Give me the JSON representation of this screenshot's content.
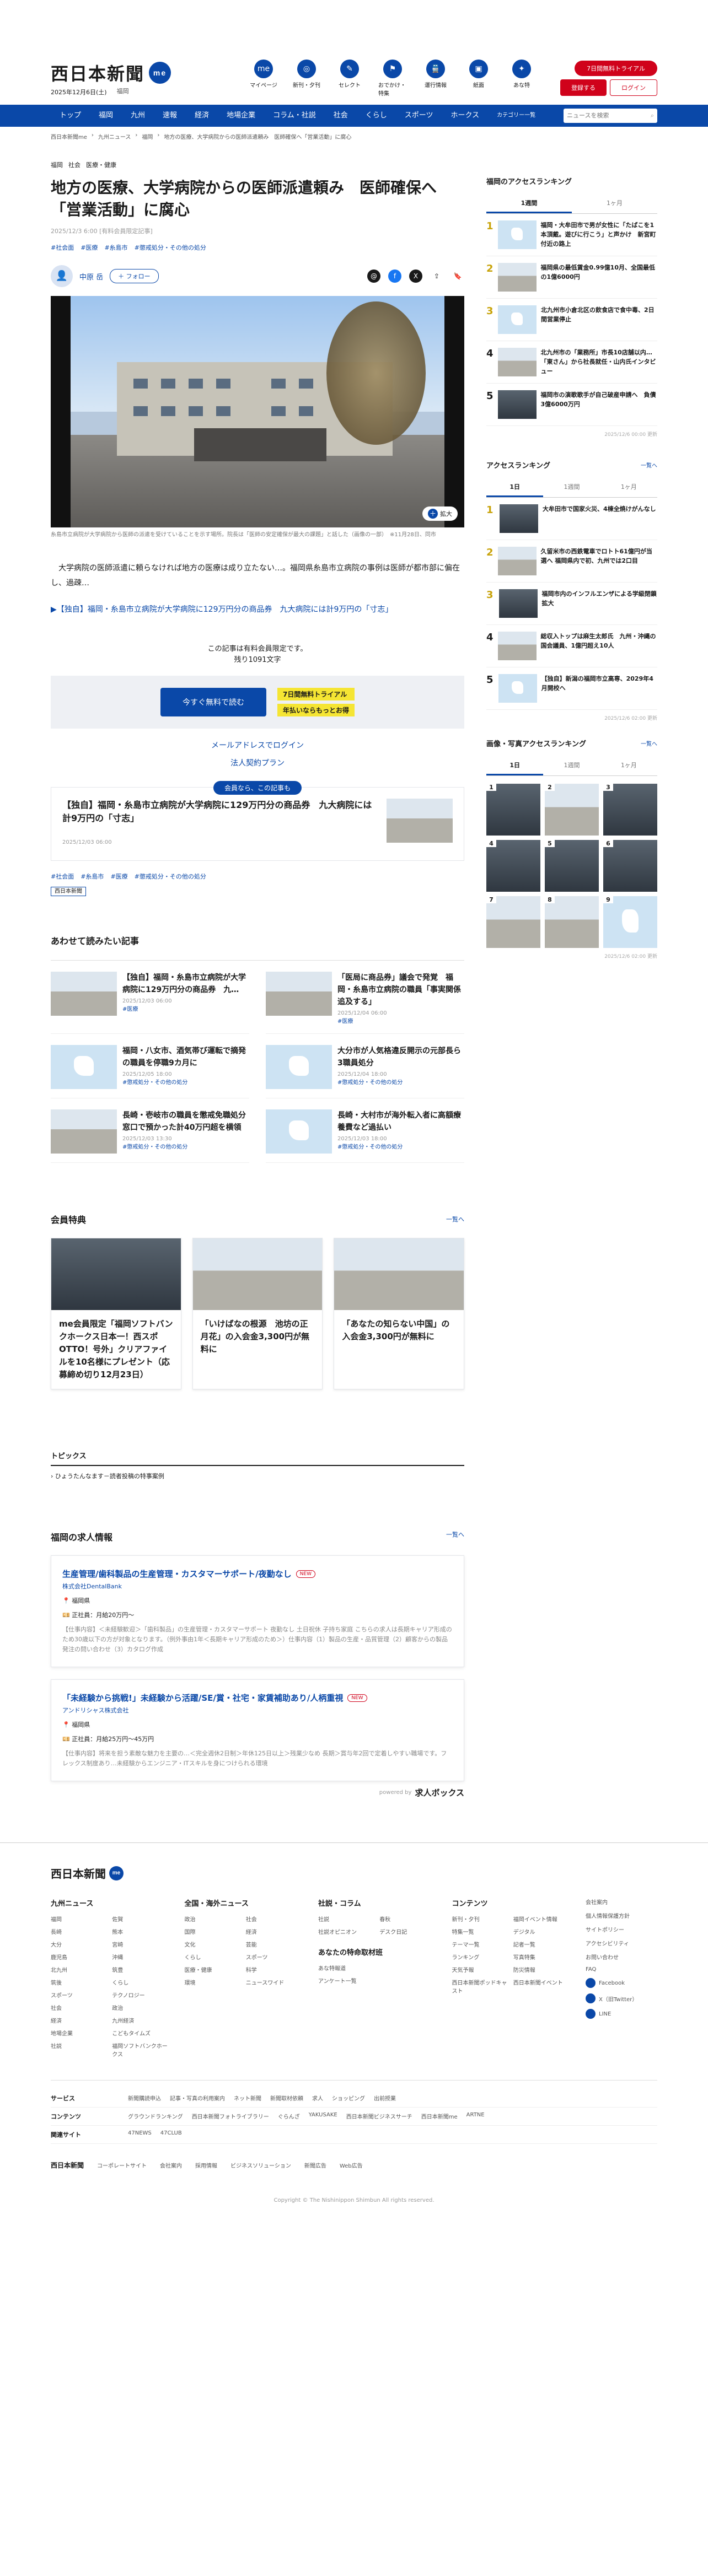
{
  "header": {
    "logo": "西日本新聞",
    "logo_me": "me",
    "date": "2025年12月6日(土)",
    "area": "福岡",
    "icons": [
      {
        "label": "マイページ",
        "icon": "mypage-icon",
        "glyph": "me"
      },
      {
        "label": "新刊・夕刊",
        "icon": "newspaper-icon",
        "glyph": "◎"
      },
      {
        "label": "セレクト",
        "icon": "select-icon",
        "glyph": "✎"
      },
      {
        "label": "おでかけ・特集",
        "icon": "outing-icon",
        "glyph": "⚑"
      },
      {
        "label": "運行情報",
        "icon": "train-icon",
        "glyph": "🚆"
      },
      {
        "label": "紙面",
        "icon": "paper-icon",
        "glyph": "▣"
      },
      {
        "label": "あな特",
        "icon": "anatoku-icon",
        "glyph": "✦"
      }
    ],
    "trial_button": "7日間無料トライアル",
    "register_button": "登録する",
    "login_button": "ログイン"
  },
  "nav": {
    "items": [
      "トップ",
      "福岡",
      "九州",
      "速報",
      "経済",
      "地場企業",
      "コラム・社説",
      "社会",
      "くらし",
      "スポーツ",
      "ホークス"
    ],
    "menu_label": "カテゴリー一覧",
    "search_placeholder": "ニュースを検索"
  },
  "breadcrumb": [
    "西日本新聞me",
    "九州ニュース",
    "福岡",
    "地方の医療、大学病院からの医師派遣頼み　医師確保へ「営業活動」に腐心"
  ],
  "article": {
    "categories": [
      "福岡",
      "社会",
      "医療・健康"
    ],
    "title": "地方の医療、大学病院からの医師派遣頼み　医師確保へ「営業活動」に腐心",
    "pubdate": "2025/12/3 6:00 [有料会員限定記事]",
    "tags": [
      "#社会面",
      "#医療",
      "#糸島市",
      "#懲戒処分・その他の処分"
    ],
    "author": "中原 岳",
    "follow": "＋ フォロー",
    "zoom": "拡大",
    "caption": "糸島市立病院が大学病院から医師の派遣を受けていることを示す場所。院長は「医師の安定確保が最大の課題」と話した（画像の一部）　※11月28日、同市",
    "lead": "　大学病院の医師派遣に頼らなければ地方の医療は成り立たない…。福岡県糸島市立病院の事例は医師が都市部に偏在し、過疎…",
    "scoop_link": "▶【独自】福岡・糸島市立病院が大学病院に129万円分の商品券　九大病院には計9万円の「寸志」"
  },
  "paywall": {
    "notice": "この記事は有料会員限定です。",
    "remaining": "残り1091文字",
    "subscribe_button": "今すぐ無料で読む",
    "badge1": "7日間無料トライアル",
    "badge2": "年払いならもっとお得",
    "login_link": "メールアドレスでログイン",
    "corp_link": "法人契約プラン"
  },
  "member_card": {
    "pill": "会員なら、この記事も",
    "title": "【独自】福岡・糸島市立病院が大学病院に129万円分の商品券　九大病院には計9万円の「寸志」",
    "date": "2025/12/03 06:00"
  },
  "tags2": [
    "#社会面",
    "#糸島市",
    "#医療",
    "#懲戒処分・その他の処分"
  ],
  "source_badge": "西日本新聞",
  "related": {
    "title": "あわせて読みたい記事",
    "items": [
      {
        "title": "【独自】福岡・糸島市立病院が大学病院に129万円分の商品券　九…",
        "meta": "2025/12/03 06:00",
        "tag": "#医療",
        "thumb": "bld"
      },
      {
        "title": "「医局に商品券」議会で発覚　福岡・糸島市立病院の職員「事実関係追及する」",
        "meta": "2025/12/04 06:00",
        "tag": "#医療",
        "thumb": "bld"
      },
      {
        "title": "福岡・八女市、酒気帯び運転で摘発の職員を停職9カ月に",
        "meta": "2025/12/05 18:00",
        "tag": "#懲戒処分・その他の処分",
        "thumb": "map"
      },
      {
        "title": "大分市が人気格違反開示の元部長ら3職員処分",
        "meta": "2025/12/04 18:00",
        "tag": "#懲戒処分・その他の処分",
        "thumb": "map"
      },
      {
        "title": "長崎・壱岐市の職員を懲戒免職処分　窓口で預かった計40万円超を横領",
        "meta": "2025/12/03 13:30",
        "tag": "#懲戒処分・その他の処分",
        "thumb": "bld"
      },
      {
        "title": "長崎・大村市が海外転入者に高額療養費など過払い",
        "meta": "2025/12/03 18:00",
        "tag": "#懲戒処分・その他の処分",
        "thumb": "map"
      }
    ]
  },
  "perks": {
    "title": "会員特典",
    "more": "一覧へ",
    "items": [
      {
        "title": "me会員限定「福岡ソフトバンクホークス日本一！西スポOTTO！号外」クリアファイルを10名様にプレゼント（応募締め切り12月23日）",
        "thumb": "dark"
      },
      {
        "title": "「いけばなの根源　池坊の正月花」の入会金3,300円が無料に",
        "thumb": "bld"
      },
      {
        "title": "「あなたの知らない中国」の入会金3,300円が無料に",
        "thumb": "bld"
      }
    ]
  },
  "topics": {
    "title": "トピックス",
    "items": [
      "ひょうたんなます－読者投稿の特事案例"
    ]
  },
  "jobs": {
    "title": "福岡の求人情報",
    "more": "一覧へ",
    "items": [
      {
        "title": "生産管理/歯科製品の生産管理・カスタマーサポート/夜勤なし",
        "new": "NEW",
        "company": "株式会社DentalBank",
        "location": "福岡県",
        "salary": "正社員：月給20万円～",
        "desc": "【仕事内容】＜未経験歓迎＞「歯科製品」の生産管理・カスタマーサポート 夜勤なし 土日祝休 子持ち家庭 こちらの求人は長期キャリア形成のため30歳以下の方が対象となります。（例外事由1年＜長期キャリア形成のため＞）仕事内容（1）製品の生産・品質管理（2）顧客からの製品発注の問い合わせ（3）カタログ作成"
      },
      {
        "title": "「未経験から挑戦!」未経験から活躍/SE/賞・社宅・家賃補助あり/人柄重視",
        "new": "NEW",
        "company": "アンドリシャス株式会社",
        "location": "福岡県",
        "salary": "正社員：月給25万円～45万円",
        "desc": "【仕事内容】将来を担う素敵な魅力を主要の…＜完全週休2日制＞年休125日以上＞残業少なめ 長期＞賞与年2回で定着しやすい職場です。フレックス制度あり…未経験からエンジニア・ITスキルを身につけられる環境"
      }
    ],
    "powered_label": "powered by",
    "powered_brand": "求人ボックス"
  },
  "sidebar": {
    "ranking1": {
      "title": "福岡のアクセスランキング",
      "tabs": [
        "1週間",
        "1ヶ月"
      ],
      "items": [
        {
          "num": "1",
          "text": "福岡・大牟田市で男が女性に「たばこを1本頂戴。遊びに行こう」と声かけ　新宮町付近の路上",
          "thumb": "map"
        },
        {
          "num": "2",
          "text": "福岡県の最低賃金0.99億10月、全国最低の1億6000円",
          "thumb": "bld"
        },
        {
          "num": "3",
          "text": "北九州市小倉北区の飲食店で食中毒、2日間営業停止",
          "thumb": "map"
        },
        {
          "num": "4",
          "text": "北九州市の「業務所」市長10店舗以内…「東さん」から社長就任・山内氏インタビュー",
          "thumb": "bld"
        },
        {
          "num": "5",
          "text": "福岡市の演歌歌手が自己破産申請へ　負債3億6000万円",
          "thumb": "dark"
        }
      ],
      "timestamp": "2025/12/6 00:00 更新"
    },
    "ranking2": {
      "title": "アクセスランキング",
      "more": "一覧へ",
      "tabs": [
        "1日",
        "1週間",
        "1ヶ月"
      ],
      "items": [
        {
          "num": "1",
          "text": "大牟田市で国家火災、4棟全焼けがんなし",
          "thumb": "dark"
        },
        {
          "num": "2",
          "text": "久留米市の西鉄電車でロトト61億円が当選へ 福岡県内で初、九州では2口目",
          "thumb": "bld"
        },
        {
          "num": "3",
          "text": "福岡市内のインフルエンザによる学級閉鎖拡大",
          "thumb": "dark"
        },
        {
          "num": "4",
          "text": "総収入トップは麻生太郎氏　九州・沖縄の国会議員、1億円超え10人",
          "thumb": "bld"
        },
        {
          "num": "5",
          "text": "【独自】新潟の福岡市立高専、2029年4月開校へ",
          "thumb": "map"
        }
      ],
      "timestamp": "2025/12/6 02:00 更新"
    },
    "photos": {
      "title": "画像・写真アクセスランキング",
      "more": "一覧へ",
      "tabs": [
        "1日",
        "1週間",
        "1ヶ月"
      ],
      "items": [
        "1",
        "2",
        "3",
        "4",
        "5",
        "6",
        "7",
        "8",
        "9"
      ],
      "timestamp": "2025/12/6 02:00 更新"
    }
  },
  "footer": {
    "logo": "西日本新聞",
    "logo_me": "me",
    "cols": [
      {
        "title": "九州ニュース",
        "items": [
          "福岡",
          "佐賀",
          "長崎",
          "熊本",
          "大分",
          "宮崎",
          "鹿児島",
          "沖縄",
          "北九州",
          "筑豊",
          "筑後",
          "くらし",
          "スポーツ",
          "テクノロジー",
          "社会",
          "政治",
          "経済",
          "九州経済",
          "地場企業",
          "こどもタイムズ",
          "社説",
          "福岡ソフトバンクホークス"
        ]
      },
      {
        "title": "全国・海外ニュース",
        "items": [
          "政治",
          "社会",
          "国際",
          "経済",
          "文化",
          "芸能",
          "くらし",
          "スポーツ",
          "医療・健康",
          "科学",
          "環境",
          "ニュースワイド"
        ]
      },
      {
        "title": "社説・コラム",
        "items": [
          "社説",
          "春秋",
          "社説オピニオン",
          "デスク日記"
        ]
      },
      {
        "title": "コンテンツ",
        "items": [
          "新刊・夕刊",
          "福岡イベント情報",
          "特集一覧",
          "デジタル",
          "テーマ一覧",
          "記者一覧",
          "ランキング",
          "写真特集",
          "天気予報",
          "防災情報",
          "西日本新聞ポッドキャスト",
          "西日本新聞イベント"
        ]
      }
    ],
    "col3_sub_title": "あなたの特命取材班",
    "col3_sub": [
      "あな特報道",
      "アンケート一覧"
    ],
    "side_links": [
      "会社案内",
      "個人情報保護方針",
      "サイトポリシー",
      "アクセシビリティ",
      "お問い合わせ",
      "FAQ"
    ],
    "social": [
      "Facebook",
      "X（旧Twitter）",
      "LINE"
    ],
    "rows": [
      {
        "label": "サービス",
        "items": [
          "新聞購読申込",
          "記事・写真の利用案内",
          "ネット新聞",
          "新聞取材依頼",
          "求人",
          "ショッピング",
          "出前授業"
        ]
      },
      {
        "label": "コンテンツ",
        "items": [
          "グラウンドランキング",
          "西日本新聞フォトライブラリー",
          "ぐらんざ",
          "YAKUSAKE",
          "西日本新聞ビジネスサーチ",
          "西日本新聞me",
          "ARTNE"
        ]
      },
      {
        "label": "関連サイト",
        "items": [
          "47NEWS",
          "47CLUB"
        ]
      }
    ],
    "bottom_logo": "西日本新聞",
    "bottom_links": [
      "コーポレートサイト",
      "会社案内",
      "採用情報",
      "ビジネスソリューション",
      "新聞広告",
      "Web広告"
    ],
    "copyright": "Copyright © The Nishinippon Shimbun All rights reserved."
  }
}
